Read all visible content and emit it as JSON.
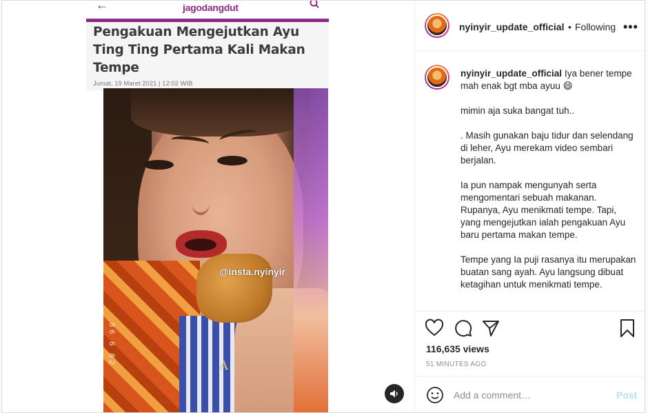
{
  "media": {
    "site_logo": "jagodangdut",
    "article_title": "Pengakuan Mengejutkan Ayu Ting Ting Pertama Kali Makan Tempe",
    "article_date": "Jumat, 19 Maret 2021 | 12:02 WIB",
    "watermark": "@insta.nyinyir",
    "video_timestamp": "86 6 82",
    "necklace_letter": "A",
    "sound_icon": "speaker-icon"
  },
  "header": {
    "username": "nyinyir_update_official",
    "separator": "•",
    "follow_status": "Following",
    "more_icon": "more-options-icon"
  },
  "caption": {
    "username": "nyinyir_update_official",
    "paragraphs": [
      "Iya bener tempe mah enak bgt mba ayuu 😄",
      "mimin aja suka bangat tuh..",
      ". Masih gunakan baju tidur dan selendang di leher, Ayu merekam video sembari berjalan.",
      "Ia pun nampak mengunyah serta mengomentari sebuah makanan. Rupanya, Ayu menikmati tempe. Tapi, yang mengejutkan ialah pengakuan Ayu baru pertama makan tempe.",
      "Tempe yang Ia puji rasanya itu merupakan buatan sang ayah. Ayu langsung dibuat ketagihan untuk menikmati tempe."
    ]
  },
  "actions": {
    "icons": [
      "heart-icon",
      "comment-icon",
      "share-icon",
      "bookmark-icon"
    ],
    "views": "116,635 views",
    "time_ago": "51 MINUTES AGO"
  },
  "add_comment": {
    "placeholder": "Add a comment…",
    "post_label": "Post",
    "post_color": "#b2dffc"
  }
}
